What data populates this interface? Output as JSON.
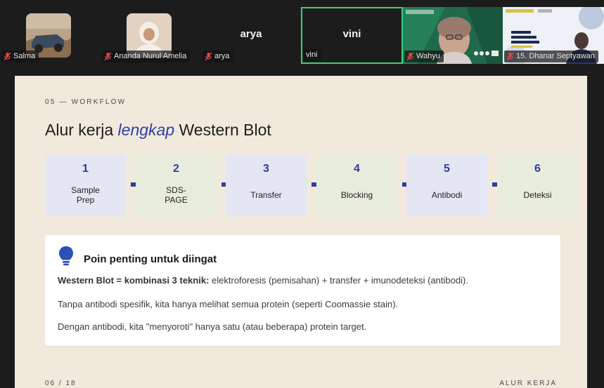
{
  "participants": [
    {
      "name": "Salma",
      "muted": true
    },
    {
      "name": "Ananda Nurul Amelia",
      "muted": true
    },
    {
      "name": "arya",
      "muted": true,
      "display_name": "arya"
    },
    {
      "name": "vini",
      "muted": false,
      "display_name": "vini"
    },
    {
      "name": "Wahyu",
      "muted": true
    },
    {
      "name": "15. Dhanar Septyawan",
      "muted": true
    }
  ],
  "slide": {
    "kicker": "05 — WORKFLOW",
    "title_before": "Alur kerja ",
    "title_emph": "lengkap",
    "title_after": " Western Blot",
    "steps": [
      {
        "num": "1",
        "label_l1": "Sample",
        "label_l2": "Prep"
      },
      {
        "num": "2",
        "label_l1": "SDS-",
        "label_l2": "PAGE"
      },
      {
        "num": "3",
        "label_l1": "Transfer",
        "label_l2": ""
      },
      {
        "num": "4",
        "label_l1": "Blocking",
        "label_l2": ""
      },
      {
        "num": "5",
        "label_l1": "Antibodi",
        "label_l2": ""
      },
      {
        "num": "6",
        "label_l1": "Deteksi",
        "label_l2": ""
      }
    ],
    "card": {
      "title": "Poin penting untuk diingat",
      "line1_bold": "Western Blot = kombinasi 3 teknik:",
      "line1_rest": "elektroforesis (pemisahan) + transfer + imunodeteksi (antibodi).",
      "line2": "Tanpa antibodi spesifik, kita hanya melihat semua protein (seperti Coomassie stain).",
      "line3": "Dengan antibodi, kita \"menyoroti\" hanya satu (atau beberapa) protein target."
    },
    "page_number": "06 / 18",
    "section": "ALUR KERJA"
  },
  "colors": {
    "accent_blue": "#2c3f9e",
    "active_speaker_border": "#3ccf7a",
    "muted_icon": "#e04848",
    "slide_bg": "#f1e9dc"
  }
}
